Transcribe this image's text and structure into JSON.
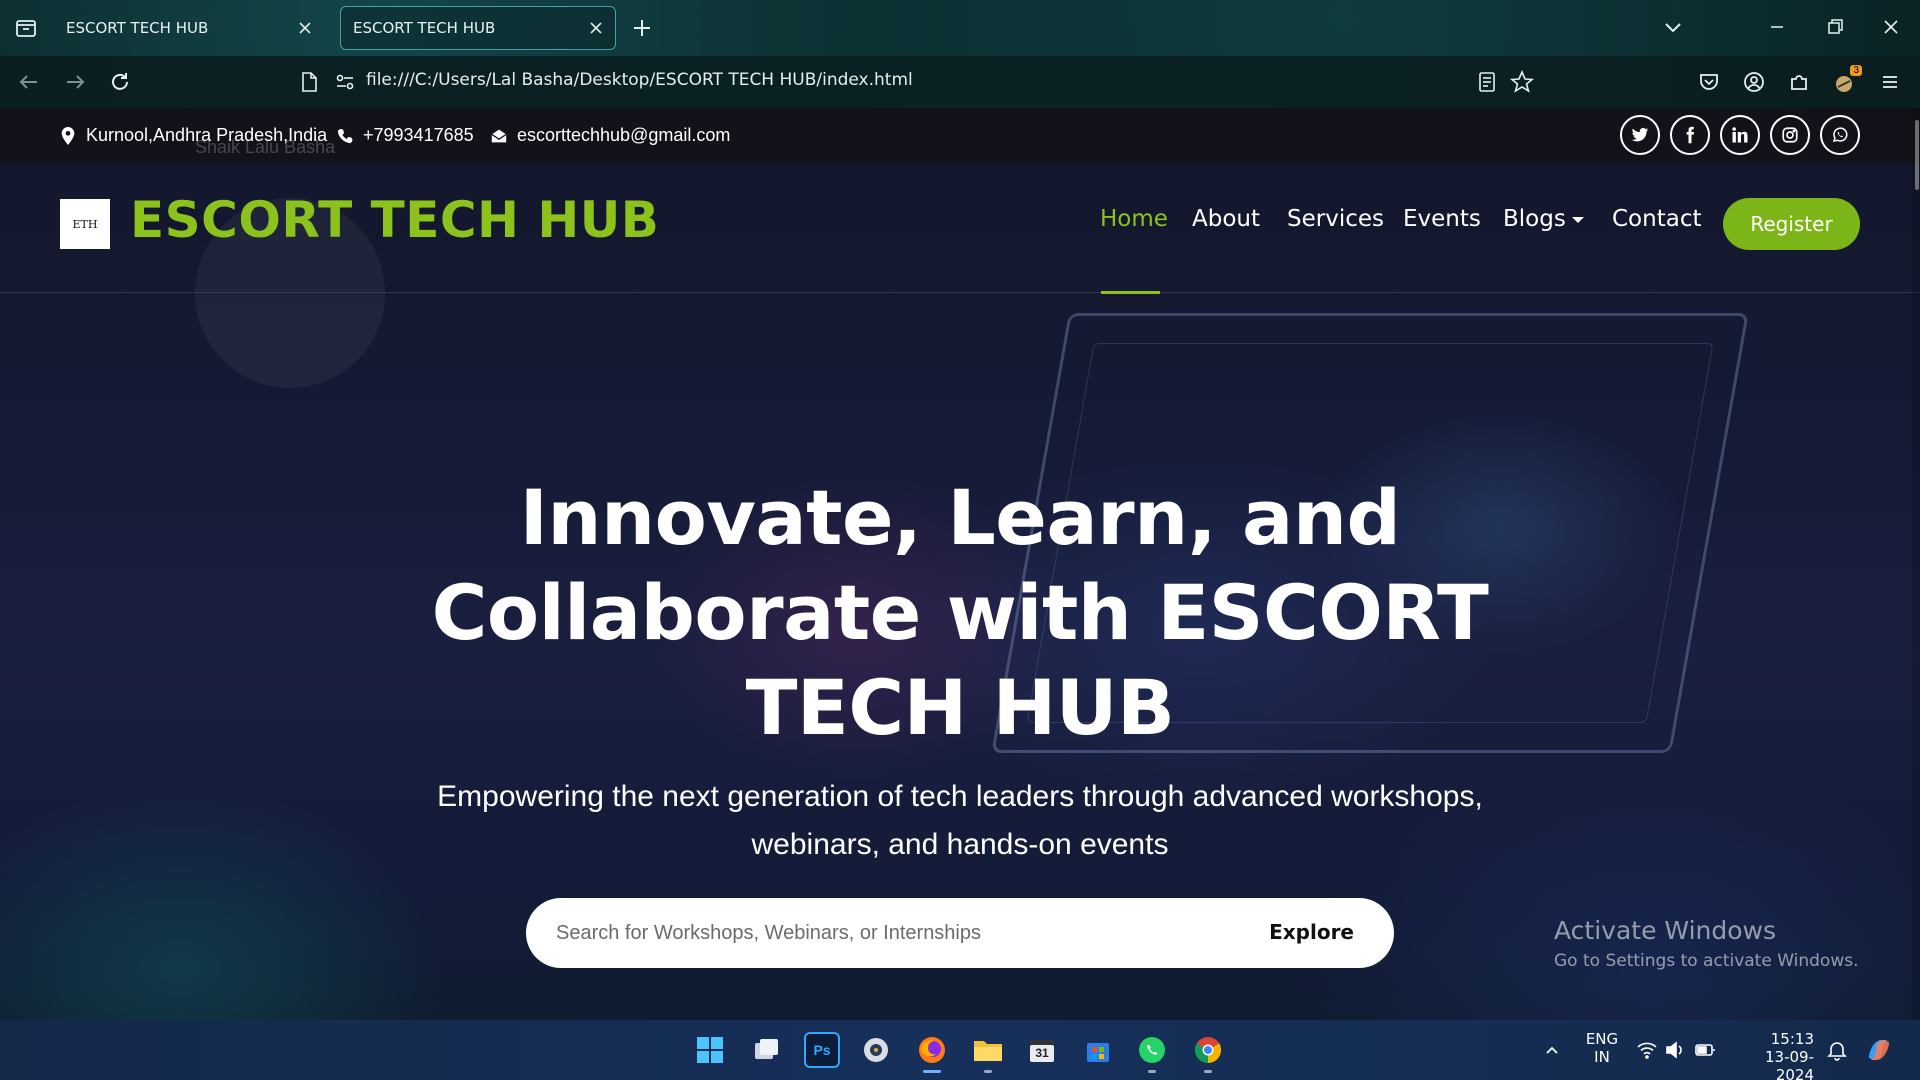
{
  "browser": {
    "tabs": [
      {
        "title": "ESCORT TECH HUB",
        "active": false
      },
      {
        "title": "ESCORT TECH HUB",
        "active": true
      }
    ],
    "url": "file:///C:/Users/Lal Basha/Desktop/ESCORT TECH HUB/index.html",
    "extension_badge": "3"
  },
  "topbar": {
    "location": "Kurnool,Andhra Pradesh,India",
    "phone": "+7993417685",
    "email": "escorttechhub@gmail.com",
    "overlay_name": "Shaik Lalu Basha",
    "social_icons": [
      "twitter-icon",
      "facebook-icon",
      "linkedin-icon",
      "instagram-icon",
      "whatsapp-icon"
    ]
  },
  "nav": {
    "logo_text": "ETH",
    "brand": "ESCORT TECH HUB",
    "links": [
      "Home",
      "About",
      "Services",
      "Events",
      "Blogs",
      "Contact"
    ],
    "active": "Home",
    "register_label": "Register"
  },
  "hero": {
    "headline": "Innovate, Learn, and Collaborate with ESCORT TECH HUB",
    "subline": "Empowering the next generation of tech leaders through advanced workshops, webinars, and hands-on events",
    "search_placeholder": "Search for Workshops, Webinars, or Internships",
    "explore_label": "Explore"
  },
  "watermark": {
    "line1": "Activate Windows",
    "line2": "Go to Settings to activate Windows."
  },
  "taskbar": {
    "language": "ENG",
    "region": "IN",
    "time": "15:13",
    "date": "13-09-2024",
    "ps_label": "Ps",
    "calendar_label": "31"
  },
  "colors": {
    "accent": "#8bc21c",
    "register_bg": "#7cb518",
    "topbar_bg": "#12121a"
  }
}
